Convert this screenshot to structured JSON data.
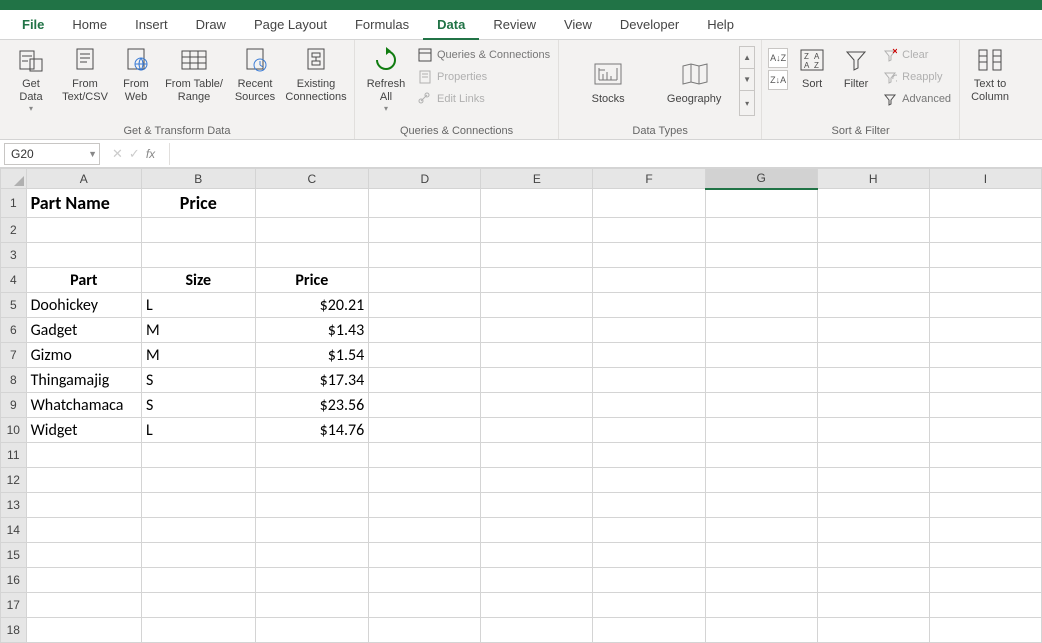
{
  "tabs": {
    "file": "File",
    "home": "Home",
    "insert": "Insert",
    "draw": "Draw",
    "page_layout": "Page Layout",
    "formulas": "Formulas",
    "data": "Data",
    "review": "Review",
    "view": "View",
    "developer": "Developer",
    "help": "Help"
  },
  "ribbon": {
    "get_transform": {
      "label": "Get & Transform Data",
      "get_data": "Get\nData",
      "from_text_csv": "From\nText/CSV",
      "from_web": "From\nWeb",
      "from_table_range": "From Table/\nRange",
      "recent_sources": "Recent\nSources",
      "existing_connections": "Existing\nConnections"
    },
    "queries": {
      "label": "Queries & Connections",
      "refresh_all": "Refresh\nAll",
      "queries_connections": "Queries & Connections",
      "properties": "Properties",
      "edit_links": "Edit Links"
    },
    "data_types": {
      "label": "Data Types",
      "stocks": "Stocks",
      "geography": "Geography"
    },
    "sort_filter": {
      "label": "Sort & Filter",
      "sort": "Sort",
      "filter": "Filter",
      "clear": "Clear",
      "reapply": "Reapply",
      "advanced": "Advanced"
    },
    "data_tools": {
      "text_to_columns": "Text to\nColumn"
    }
  },
  "name_box": "G20",
  "formula": "",
  "columns": [
    "A",
    "B",
    "C",
    "D",
    "E",
    "F",
    "G",
    "H",
    "I"
  ],
  "rows": [
    "1",
    "2",
    "3",
    "4",
    "5",
    "6",
    "7",
    "8",
    "9",
    "10",
    "11",
    "12",
    "13",
    "14",
    "15",
    "16",
    "17",
    "18"
  ],
  "selected_column": "G",
  "cells": {
    "r1": {
      "A": "Part Name",
      "B": "Price"
    },
    "r4": {
      "A": "Part",
      "B": "Size",
      "C": "Price"
    },
    "r5": {
      "A": "Doohickey",
      "B": "L",
      "C": "$20.21"
    },
    "r6": {
      "A": "Gadget",
      "B": "M",
      "C": "$1.43"
    },
    "r7": {
      "A": "Gizmo",
      "B": "M",
      "C": "$1.54"
    },
    "r8": {
      "A": "Thingamajig",
      "B": "S",
      "C": "$17.34"
    },
    "r9": {
      "A": "Whatchamaca",
      "B": "S",
      "C": "$23.56"
    },
    "r10": {
      "A": "Widget",
      "B": "L",
      "C": "$14.76"
    }
  }
}
